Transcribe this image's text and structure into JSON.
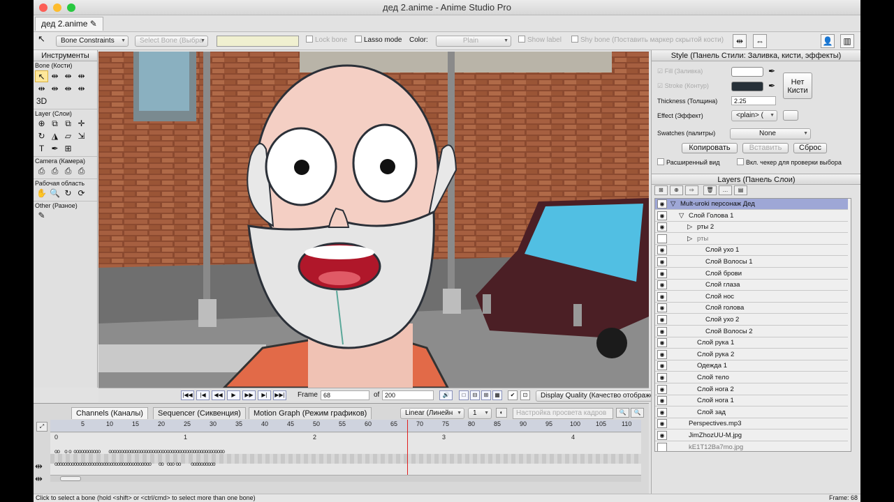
{
  "window": {
    "title": "дед 2.anime - Anime Studio Pro",
    "doc_tab": "дед 2.anime",
    "pencil_icon": "✎"
  },
  "toolbar": {
    "bone_constraints": "Bone Constraints",
    "select_bone": "Select Bone (Выбра",
    "lock_bone": "Lock bone",
    "lasso_mode": "Lasso mode",
    "color_label": "Color:",
    "color_value": "Plain",
    "show_label": "Show label",
    "shy_bone": "Shy bone (Поставить маркер скрытой кости)"
  },
  "tools": {
    "title": "Инструменты",
    "bone": "Bone (Кости)",
    "layer": "Layer (Слои)",
    "camera": "Camera (Камера)",
    "workspace": "Рабочая область",
    "other": "Other (Разное)",
    "label_3d": "3D"
  },
  "canvas_bar": {
    "frame_label": "Frame",
    "frame_value": "68",
    "of_label": "of",
    "frame_total": "200",
    "display_quality": "Display Quality (Качество отображения)"
  },
  "timeline": {
    "tabs": [
      "Channels (Каналы)",
      "Sequencer (Сиквенция)",
      "Motion Graph (Режим графиков)"
    ],
    "interp": "Linear (Линейн",
    "interp_num": "1",
    "onion": "Настройка просвета кадров",
    "ticks": [
      "5",
      "10",
      "15",
      "20",
      "25",
      "30",
      "35",
      "40",
      "45",
      "50",
      "55",
      "60",
      "65",
      "70",
      "75",
      "80",
      "85",
      "90",
      "95",
      "100",
      "105",
      "110"
    ],
    "sub_ticks": [
      "0",
      "1",
      "2",
      "3",
      "4"
    ],
    "current_frame": 68
  },
  "status": {
    "hint": "Click to select a bone (hold <shift> or <ctrl/cmd> to select more than one bone)",
    "frame": "Frame: 68"
  },
  "style": {
    "title": "Style (Панель Стили: Заливка, кисти, эффекты)",
    "fill": "Fill (Заливка)",
    "stroke": "Stroke (Контур)",
    "thickness_label": "Thickness (Толщина)",
    "thickness_value": "2.25",
    "effect_label": "Effect (Эффект)",
    "effect_value": "<plain> (",
    "no_brush": "Нет Кисти",
    "swatches_label": "Swatches (палитры)",
    "swatches_value": "None",
    "copy": "Копировать",
    "paste": "Вставить",
    "reset": "Сброс",
    "advanced": "Расширенный вид",
    "checker": "Вкл. чекер для проверки выбора",
    "fill_color": "#ffffff",
    "stroke_color": "#263038"
  },
  "layers": {
    "title": "Layers (Панель Слои)",
    "items": [
      {
        "name": "Mult-uroki персонаж Дед",
        "depth": 0,
        "selected": true,
        "icon": "▽"
      },
      {
        "name": "Слой Голова 1",
        "depth": 1,
        "icon": "▽"
      },
      {
        "name": "рты 2",
        "depth": 2,
        "icon": "▷"
      },
      {
        "name": "рты",
        "depth": 2,
        "icon": "▷",
        "hidden": true
      },
      {
        "name": "Слой ухо 1",
        "depth": 3
      },
      {
        "name": "Слой Волосы 1",
        "depth": 3
      },
      {
        "name": "Слой брови",
        "depth": 3
      },
      {
        "name": "Слой глаза",
        "depth": 3
      },
      {
        "name": "Слой нос",
        "depth": 3
      },
      {
        "name": "Слой голова",
        "depth": 3
      },
      {
        "name": "Слой ухо 2",
        "depth": 3
      },
      {
        "name": "Слой Волосы 2",
        "depth": 3
      },
      {
        "name": "Слой рука 1",
        "depth": 2
      },
      {
        "name": "Слой рука 2",
        "depth": 2
      },
      {
        "name": "Одежда 1",
        "depth": 2
      },
      {
        "name": "Слой тело",
        "depth": 2
      },
      {
        "name": "Слой нога 2",
        "depth": 2
      },
      {
        "name": "Слой нога 1",
        "depth": 2
      },
      {
        "name": "Слой зад",
        "depth": 2
      },
      {
        "name": "Perspectives.mp3",
        "depth": 1
      },
      {
        "name": "JimZhozUU-M.jpg",
        "depth": 1
      },
      {
        "name": "kE1T12Ba7mo.jpg",
        "depth": 1,
        "hidden": true
      }
    ]
  }
}
